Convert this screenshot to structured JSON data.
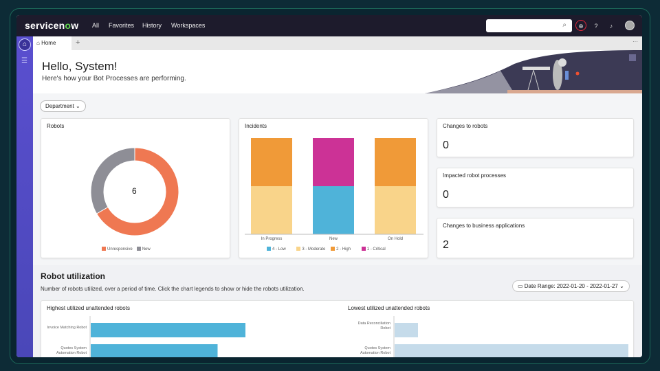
{
  "topnav": {
    "logo": "servicenow",
    "logo_a": "servicen",
    "logo_o": "o",
    "logo_w": "w",
    "items": [
      "All",
      "Favorites",
      "History",
      "Workspaces"
    ],
    "search_placeholder": ""
  },
  "tabs": {
    "home": "Home",
    "add": "+",
    "more": "···"
  },
  "hero": {
    "title": "Hello, System!",
    "subtitle": "Here's how your Bot Processes are performing."
  },
  "filter": {
    "department": "Department"
  },
  "robots": {
    "title": "Robots",
    "total": "6",
    "legend": [
      "Unresponsive",
      "New"
    ]
  },
  "incidents": {
    "title": "Incidents",
    "legend": [
      "4 - Low",
      "3 - Moderate",
      "2 - High",
      "1 - Critical"
    ]
  },
  "stats": [
    {
      "title": "Changes to robots",
      "value": "0"
    },
    {
      "title": "Impacted robot processes",
      "value": "0"
    },
    {
      "title": "Changes to business applications",
      "value": "2"
    }
  ],
  "utilization": {
    "title": "Robot utilization",
    "description": "Number of robots utilized, over a period of time. Click the chart legends to show or hide the robots utilization.",
    "date_range": "Date Range: 2022-01-20 - 2022-01-27",
    "highest_title": "Highest utilized unattended robots",
    "lowest_title": "Lowest utilized unattended robots"
  },
  "chart_data": [
    {
      "type": "pie",
      "title": "Robots",
      "categories": [
        "Unresponsive",
        "New"
      ],
      "values": [
        4,
        2
      ],
      "colors": [
        "#ef7852",
        "#8e8e96"
      ],
      "center_label": "6"
    },
    {
      "type": "bar",
      "stacked": true,
      "title": "Incidents",
      "categories": [
        "In Progress",
        "New",
        "On Hold"
      ],
      "series": [
        {
          "name": "4 - Low",
          "color": "#4fb3d9",
          "values": [
            0,
            1,
            0
          ]
        },
        {
          "name": "3 - Moderate",
          "color": "#f9d48a",
          "values": [
            1,
            0,
            1
          ]
        },
        {
          "name": "2 - High",
          "color": "#f09a38",
          "values": [
            1,
            0,
            1
          ]
        },
        {
          "name": "1 - Critical",
          "color": "#cc3296",
          "values": [
            0,
            1,
            0
          ]
        }
      ]
    },
    {
      "type": "bar",
      "orientation": "horizontal",
      "title": "Highest utilized unattended robots",
      "categories": [
        "Invoice Matching Robot",
        "Quotes System Automation Robot"
      ],
      "values": [
        100,
        82
      ],
      "color": "#4fb3d9"
    },
    {
      "type": "bar",
      "orientation": "horizontal",
      "title": "Lowest utilized unattended robots",
      "categories": [
        "Data Reconciliation Robot",
        "Quotes System Automation Robot"
      ],
      "values": [
        10,
        100
      ],
      "color": "#c5dbea"
    }
  ]
}
